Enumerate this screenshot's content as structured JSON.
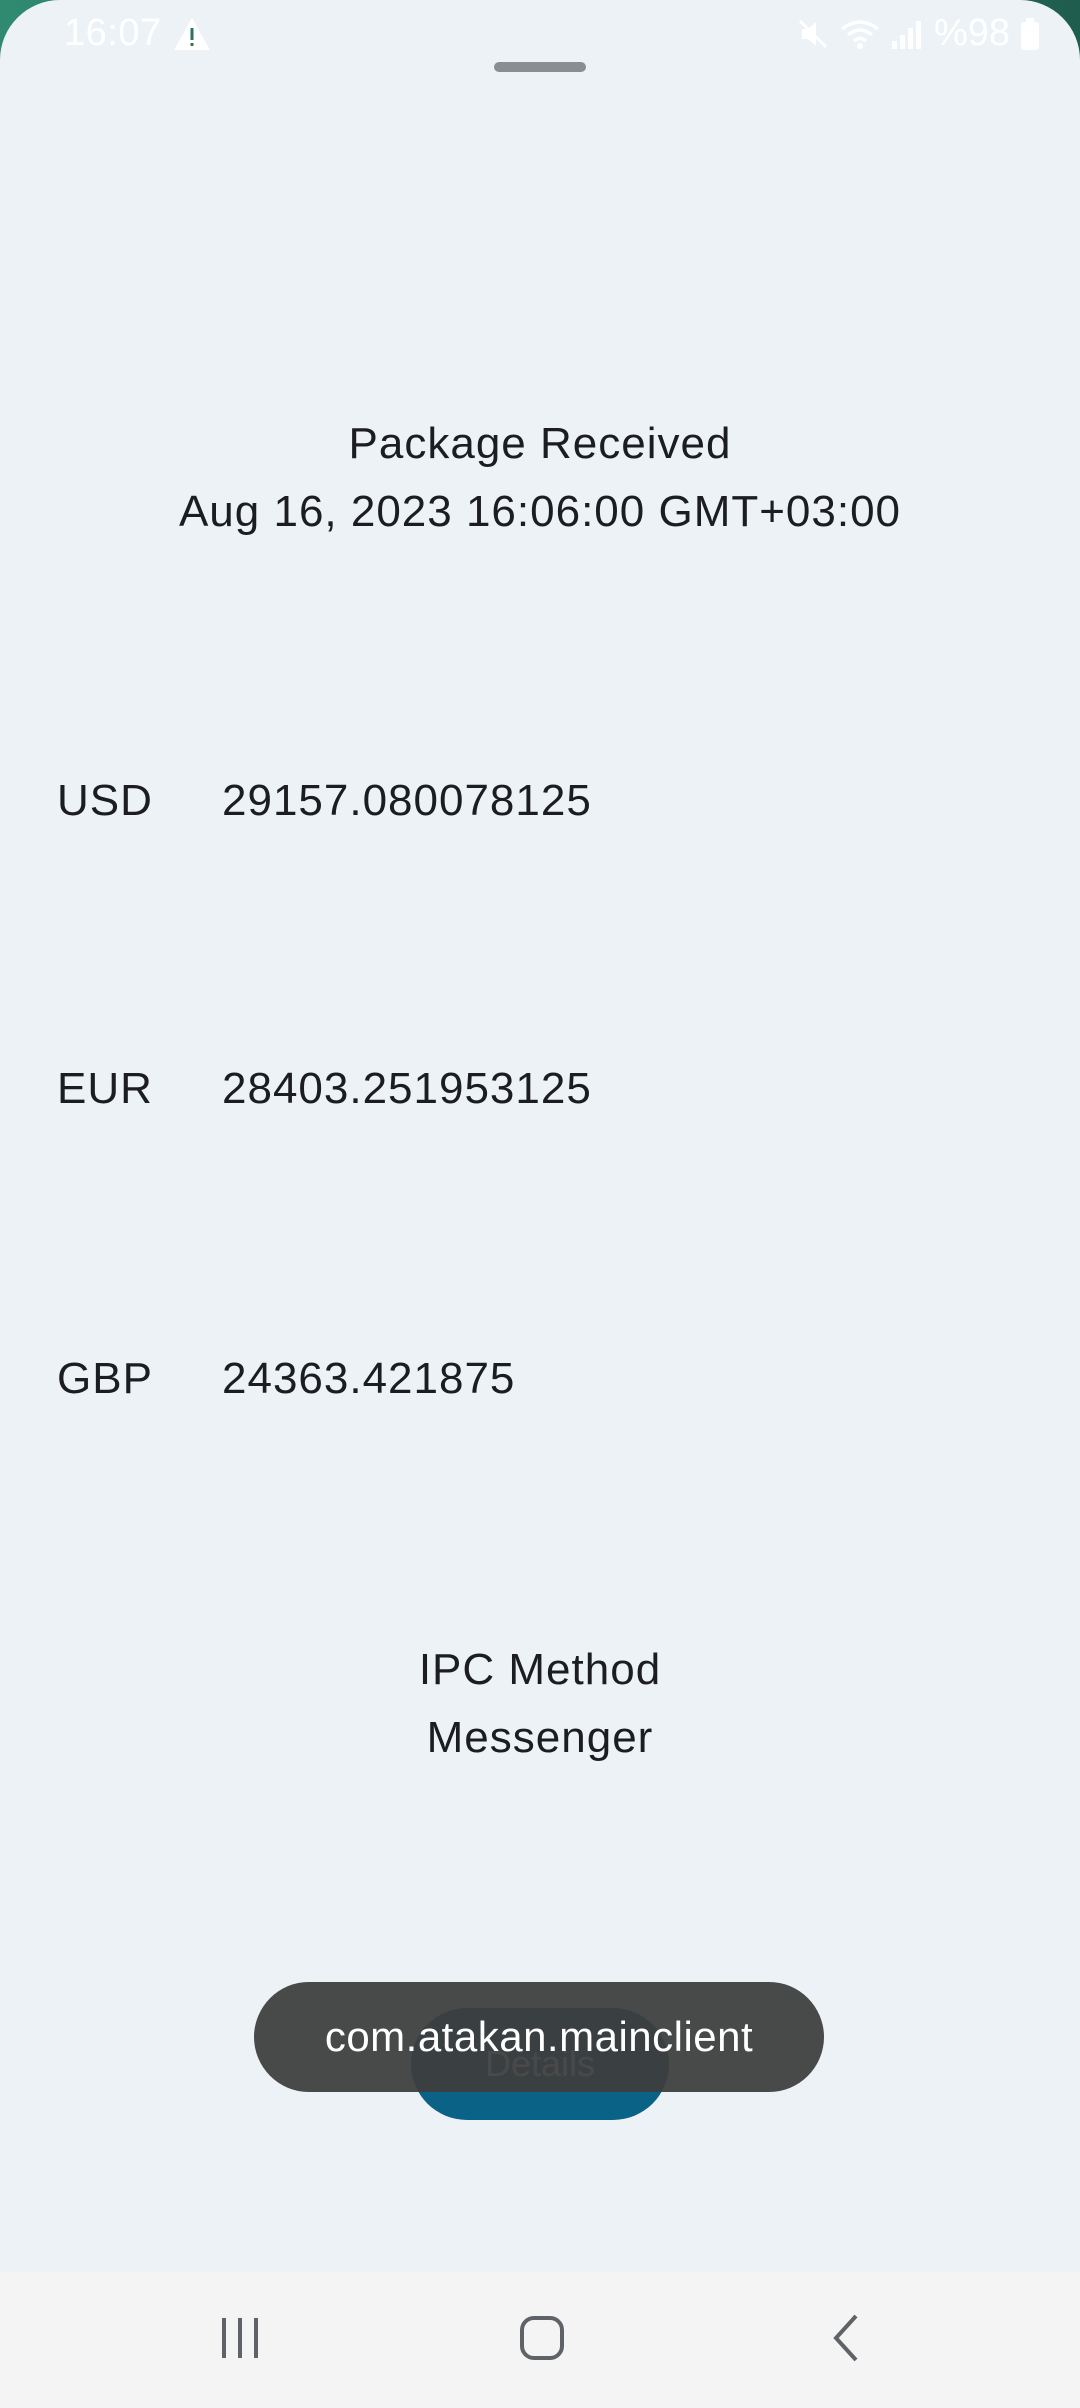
{
  "status_bar": {
    "time": "16:07",
    "battery": "%98",
    "icons": [
      "warning-icon",
      "mute-icon",
      "wifi-icon",
      "signal-icon",
      "battery-icon"
    ]
  },
  "package": {
    "title": "Package Received",
    "timestamp": "Aug 16, 2023 16:06:00 GMT+03:00"
  },
  "rates": [
    {
      "code": "USD",
      "value": "29157.080078125"
    },
    {
      "code": "EUR",
      "value": "28403.251953125"
    },
    {
      "code": "GBP",
      "value": "24363.421875"
    }
  ],
  "ipc": {
    "label": "IPC Method",
    "method": "Messenger"
  },
  "details_button": {
    "label": "Details"
  },
  "toast": {
    "text": "com.atakan.mainclient"
  },
  "nav_bar": {
    "icons": [
      "recent-apps-icon",
      "home-icon",
      "back-icon"
    ]
  },
  "colors": {
    "background": "#edf2f6",
    "accent": "#0a6286",
    "toast": "#3e3e3e",
    "text": "#1c1d20"
  }
}
